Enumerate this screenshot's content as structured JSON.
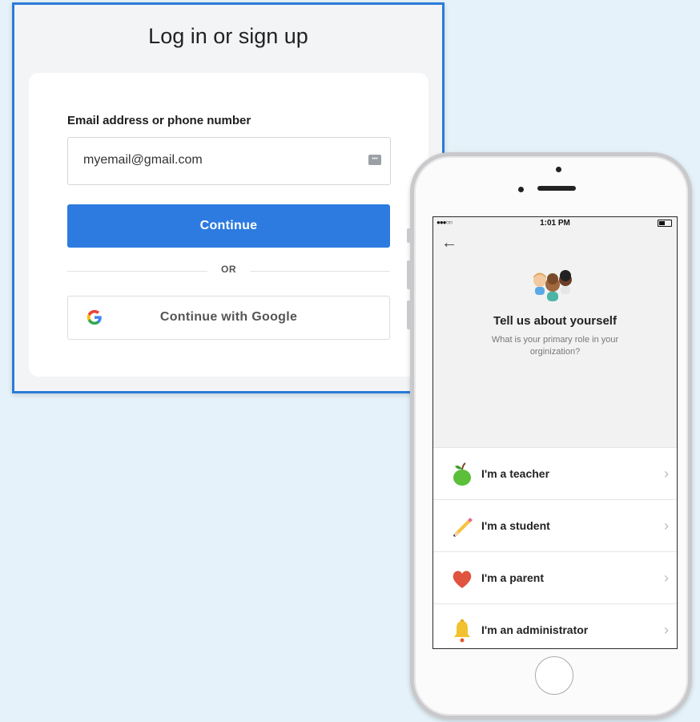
{
  "login": {
    "title": "Log in or sign up",
    "email_label": "Email address or phone number",
    "email_value": "myemail@gmail.com",
    "continue_label": "Continue",
    "or_text": "OR",
    "google_label": "Continue with Google",
    "accent": "#2d7be0"
  },
  "phone": {
    "status": {
      "signal": "●●●○○",
      "time": "1:01 PM"
    },
    "title": "Tell us about yourself",
    "subtitle": "What is your primary role in your orginization?",
    "roles": [
      {
        "label": "I'm a teacher",
        "icon": "apple-icon"
      },
      {
        "label": "I'm a student",
        "icon": "pencil-icon"
      },
      {
        "label": "I'm a parent",
        "icon": "heart-icon"
      },
      {
        "label": "I'm an administrator",
        "icon": "bell-icon"
      }
    ]
  }
}
